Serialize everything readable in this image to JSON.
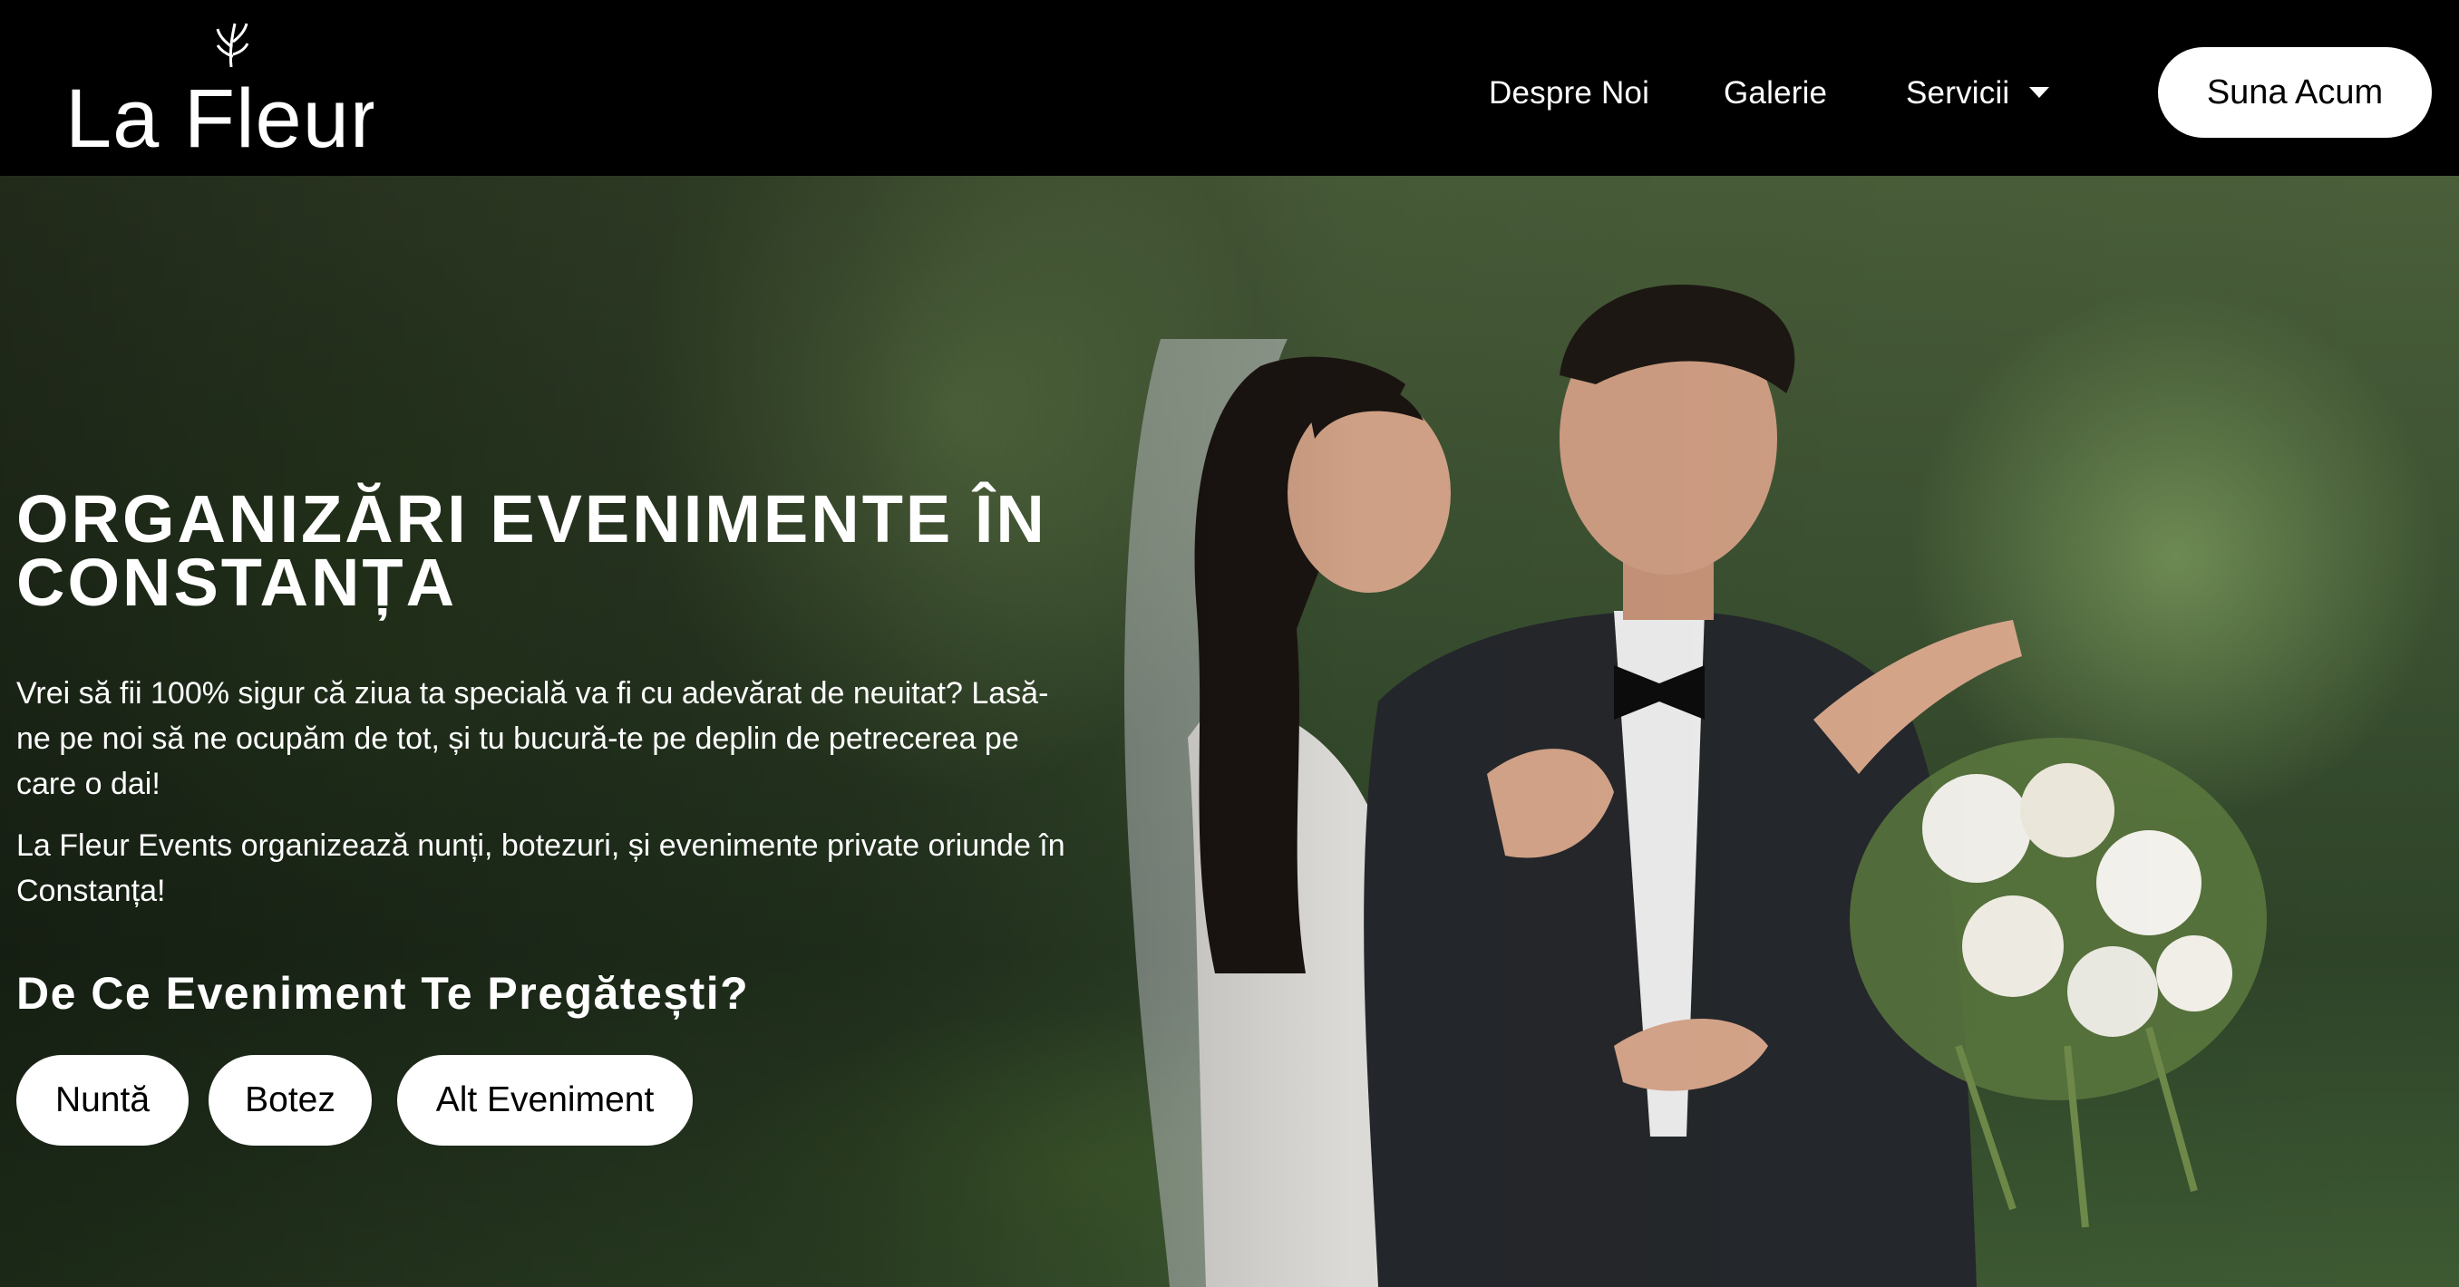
{
  "brand": {
    "logo_text": "La Fleur"
  },
  "nav": {
    "items": [
      {
        "label": "Despre Noi"
      },
      {
        "label": "Galerie"
      },
      {
        "label": "Servicii"
      }
    ],
    "cta_label": "Suna Acum"
  },
  "hero": {
    "title": "ORGANIZĂRI EVENIMENTE ÎN CONSTANȚA",
    "intro": "Vrei să fii 100% sigur că ziua ta specială va fi cu adevărat de neuitat? Lasă-ne pe noi să ne ocupăm de tot, și tu bucură-te pe deplin de petrecerea pe care o dai!",
    "description": "La Fleur Events organizează nunți, botezuri, și evenimente private oriunde în Constanța!",
    "question": "De Ce Eveniment Te Pregătești?",
    "event_buttons": [
      {
        "label": "Nuntă"
      },
      {
        "label": "Botez"
      },
      {
        "label": "Alt Eveniment"
      }
    ]
  },
  "icons": {
    "servicii_dropdown": "chevron-down-icon",
    "logo_sprig": "sprig-icon"
  },
  "colors": {
    "header_bg": "#000000",
    "button_bg": "#ffffff",
    "button_text": "#000000",
    "hero_text": "#ffffff"
  }
}
